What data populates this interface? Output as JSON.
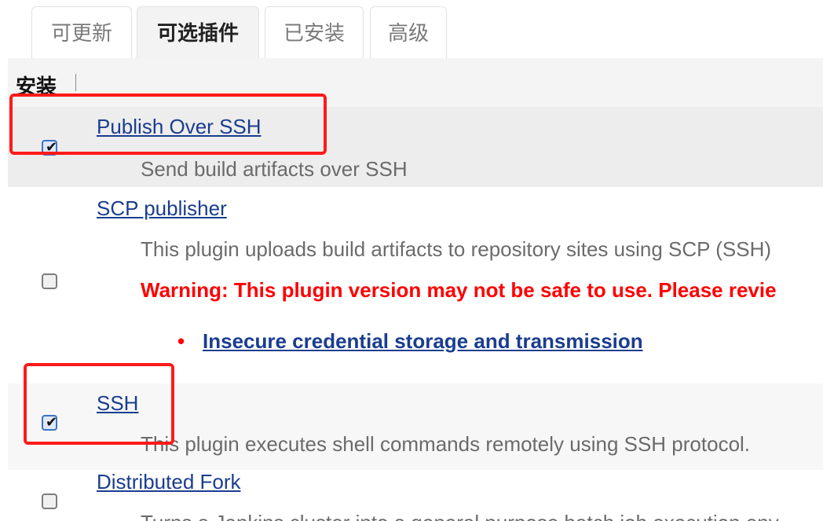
{
  "tabs": [
    {
      "label": "可更新"
    },
    {
      "label": "可选插件",
      "active": true
    },
    {
      "label": "已安装"
    },
    {
      "label": "高级"
    }
  ],
  "table_header": {
    "install": "安装"
  },
  "plugins": [
    {
      "name": "Publish Over SSH",
      "description": "Send build artifacts over SSH",
      "checked": true
    },
    {
      "name": "SCP publisher",
      "description": "This plugin uploads build artifacts to repository sites using SCP (SSH)",
      "warning": "Warning: This plugin version may not be safe to use. Please revie",
      "vulnerability": "Insecure credential storage and transmission",
      "checked": false
    },
    {
      "name": "SSH",
      "description": "This plugin executes shell commands remotely using SSH protocol.",
      "checked": true
    },
    {
      "name": "Distributed Fork",
      "description": "Turns a Jenkins cluster into a general purpose batch job execution env",
      "checked": false
    }
  ],
  "colors": {
    "link": "#1a3d8f",
    "warning": "#ff0000",
    "highlight_box": "#ff1a1a",
    "checkbox_checked_border": "#3b73c8"
  },
  "icons": [
    "checkmark-icon"
  ]
}
